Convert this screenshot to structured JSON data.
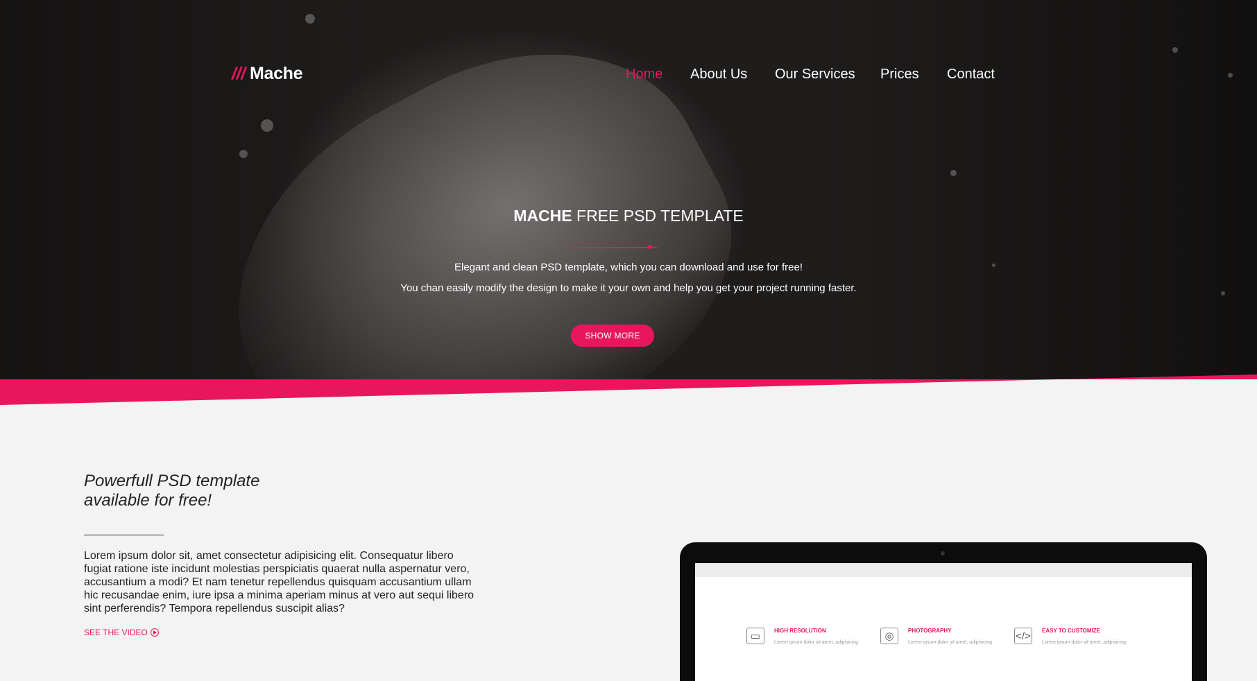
{
  "brand": {
    "slashes": "///",
    "name": "Mache",
    "accent_color": "#e8175d"
  },
  "nav": {
    "items": [
      {
        "label": "Home",
        "active": true
      },
      {
        "label": "About Us",
        "active": false
      },
      {
        "label": "Our Services",
        "active": false
      },
      {
        "label": "Prices",
        "active": false
      },
      {
        "label": "Contact",
        "active": false
      }
    ]
  },
  "hero": {
    "title_bold": "MACHE",
    "title_rest": " FREE PSD TEMPLATE",
    "line1": "Elegant and clean PSD template, which you can download and use for free!",
    "line2": "You chan easily modify the design to make it your own and help you get your project running faster.",
    "button": "SHOW MORE"
  },
  "intro": {
    "title_line1": "Powerfull PSD template",
    "title_line2": "available for free!",
    "body": "Lorem ipsum dolor sit, amet consectetur adipisicing elit. Consequatur libero fugiat ratione iste incidunt molestias perspiciatis quaerat nulla aspernatur vero, accusantium a modi? Et nam tenetur repellendus quisquam accusantium ullam hic recusandae enim, iure ipsa a minima aperiam minus at vero aut sequi libero sint perferendis? Tempora repellendus suscipit alias?",
    "video_link": "SEE THE VIDEO"
  },
  "laptop_features": [
    {
      "title": "HIGH RESOLUTION",
      "text": "Lorem ipsum dolor sit amet, adipisicing",
      "icon": "monitor-icon"
    },
    {
      "title": "PHOTOGRAPHY",
      "text": "Lorem ipsum dolor sit amet, adipisicing",
      "icon": "camera-icon"
    },
    {
      "title": "EASY TO CUSTOMIZE",
      "text": "Lorem ipsum dolor sit amet, adipisicing",
      "icon": "code-icon"
    }
  ]
}
